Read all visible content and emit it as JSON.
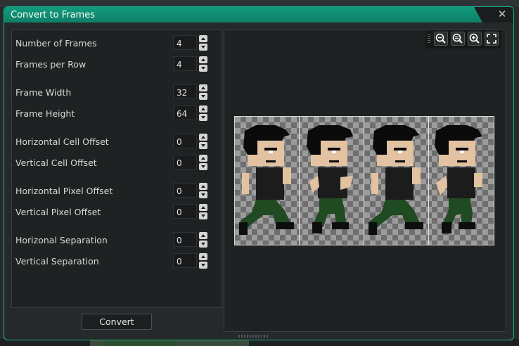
{
  "dialog": {
    "title": "Convert to Frames",
    "close_icon": "close-icon"
  },
  "fields": [
    {
      "label": "Number of Frames",
      "value": "4"
    },
    {
      "label": "Frames per Row",
      "value": "4"
    },
    {
      "label": "Frame Width",
      "value": "32"
    },
    {
      "label": "Frame Height",
      "value": "64"
    },
    {
      "label": "Horizontal Cell Offset",
      "value": "0"
    },
    {
      "label": "Vertical Cell Offset",
      "value": "0"
    },
    {
      "label": "Horizontal Pixel Offset",
      "value": "0"
    },
    {
      "label": "Vertical Pixel Offset",
      "value": "0"
    },
    {
      "label": "Horizonal Separation",
      "value": "0"
    },
    {
      "label": "Vertical Separation",
      "value": "0"
    }
  ],
  "actions": {
    "convert_label": "Convert"
  },
  "preview": {
    "toolbar_icons": [
      "zoom-out-icon",
      "zoom-reset-icon",
      "zoom-in-icon",
      "fit-screen-icon"
    ],
    "frame_count": 4
  },
  "colors": {
    "accent": "#129b7e",
    "hair": "#0a0a0a",
    "skin": "#e2c2a0",
    "shirt": "#1c1c1c",
    "pants": "#1f4a22"
  }
}
